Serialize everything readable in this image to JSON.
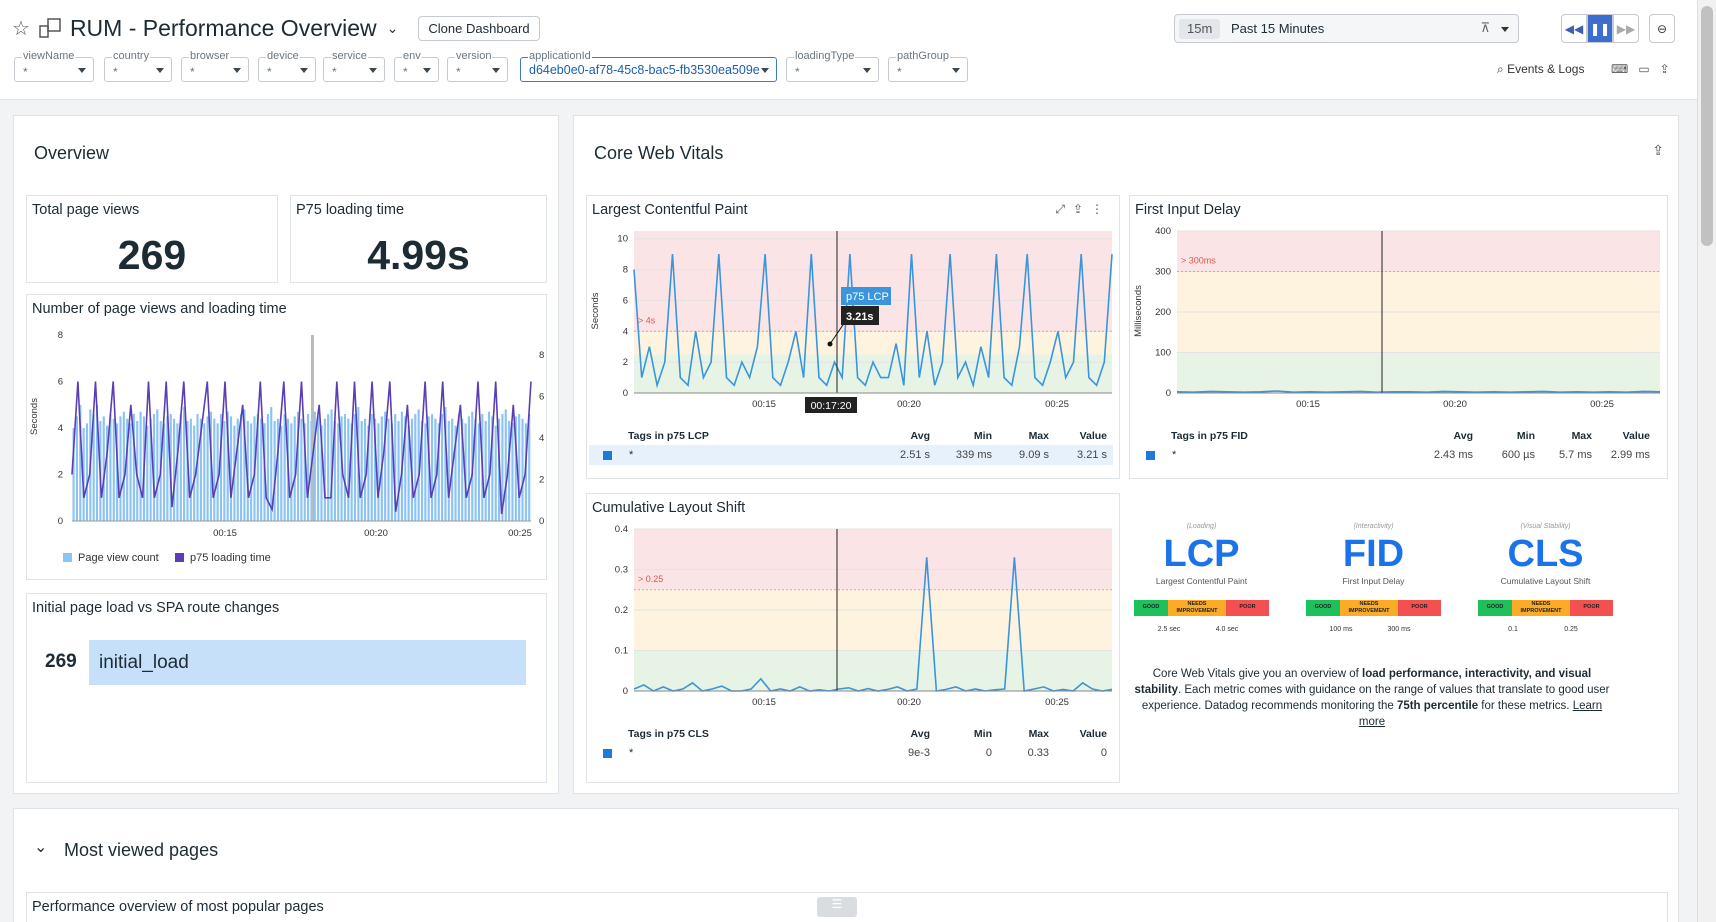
{
  "header": {
    "title": "RUM - Performance Overview",
    "clone_label": "Clone Dashboard",
    "time_short": "15m",
    "time_label": "Past 15 Minutes",
    "events_logs": "Events & Logs"
  },
  "variables": [
    {
      "name": "viewName",
      "value": "*"
    },
    {
      "name": "country",
      "value": "*"
    },
    {
      "name": "browser",
      "value": "*"
    },
    {
      "name": "device",
      "value": "*"
    },
    {
      "name": "service",
      "value": "*"
    },
    {
      "name": "env",
      "value": "*"
    },
    {
      "name": "version",
      "value": "*"
    },
    {
      "name": "applicationId",
      "value": "d64eb0e0-af78-45c8-bac5-fb3530ea509e"
    },
    {
      "name": "loadingType",
      "value": "*"
    },
    {
      "name": "pathGroup",
      "value": "*"
    }
  ],
  "overview": {
    "title": "Overview",
    "total_views_label": "Total page views",
    "total_views": "269",
    "p75_label": "P75 loading time",
    "p75_value": "4.99s",
    "views_chart_title": "Number of page views and loading time",
    "legend_views": "Page view count",
    "legend_loading": "p75 loading time",
    "spa_title": "Initial page load vs SPA route changes",
    "spa_count": "269",
    "spa_label": "initial_load"
  },
  "cwv": {
    "title": "Core Web Vitals",
    "lcp": {
      "title": "Largest Contentful Paint",
      "tags_label": "Tags in p75 LCP",
      "tag": "*",
      "avg": "2.51 s",
      "min": "339 ms",
      "max": "9.09 s",
      "value": "3.21 s",
      "threshold": "> 4s",
      "tooltip_name": "p75 LCP",
      "tooltip_val": "3.21s",
      "crosshair": "00:17:20"
    },
    "fid": {
      "title": "First Input Delay",
      "tags_label": "Tags in p75 FID",
      "tag": "*",
      "avg": "2.43 ms",
      "min": "600 µs",
      "max": "5.7 ms",
      "value": "2.99 ms",
      "threshold": "> 300ms"
    },
    "cls": {
      "title": "Cumulative Layout Shift",
      "tags_label": "Tags in p75 CLS",
      "tag": "*",
      "avg": "9e-3",
      "min": "0",
      "max": "0.33",
      "value": "0",
      "threshold": "> 0.25"
    },
    "col_avg": "Avg",
    "col_min": "Min",
    "col_max": "Max",
    "col_value": "Value",
    "vitals": [
      {
        "abbr": "LCP",
        "sub": "(Loading)",
        "name": "Largest Contentful Paint",
        "t1": "2.5 sec",
        "t2": "4.0 sec"
      },
      {
        "abbr": "FID",
        "sub": "(Interactivity)",
        "name": "First Input Delay",
        "t1": "100 ms",
        "t2": "300 ms"
      },
      {
        "abbr": "CLS",
        "sub": "(Visual Stability)",
        "name": "Cumulative Layout Shift",
        "t1": "0.1",
        "t2": "0.25"
      }
    ],
    "good": "GOOD",
    "needs": "NEEDS IMPROVEMENT",
    "poor": "POOR",
    "desc_1": "Core Web Vitals give you an overview of ",
    "desc_b1": "load performance, interactivity, and visual stability",
    "desc_2": ". Each metric comes with guidance on the range of values that translate to good user experience. Datadog recommends monitoring the ",
    "desc_b2": "75th percentile",
    "desc_3": " for these metrics. ",
    "learn_more": "Learn more"
  },
  "most_viewed": {
    "title": "Most viewed pages",
    "sub_title": "Performance overview of most popular pages"
  },
  "chart_data": [
    {
      "type": "bar",
      "title": "Number of page views and loading time",
      "ylabel": "Seconds",
      "x_ticks": [
        "00:15",
        "00:20",
        "00:25"
      ],
      "y_left": [
        0,
        2,
        4,
        6,
        8
      ],
      "y_right": [
        0,
        2,
        4,
        6,
        8
      ],
      "series": [
        {
          "name": "Page view count",
          "values": [
            4,
            4.5,
            5,
            4,
            4.2,
            4.8,
            4.6,
            5,
            4.3,
            4.5,
            4.1,
            4.6,
            4.4,
            4.2,
            4.5,
            4.7,
            4.4,
            4.2,
            4.6,
            4.3,
            4.7,
            4.5,
            4.1,
            4.4,
            4.6,
            4.8,
            4.3,
            4.2,
            4.5,
            4.6,
            4.4,
            4.2,
            4.6,
            4.9,
            4.3,
            4.4,
            4.1,
            4.6,
            4.4,
            4.2,
            4.5,
            4.7,
            4.4,
            4.2,
            4.6,
            4.3,
            4.7,
            4.5,
            4.1,
            4.4,
            4.6,
            4.8,
            4.3,
            4.2,
            4.5,
            4.6,
            4.4,
            4.2,
            4.6,
            4.9,
            4.3,
            4.4,
            4.1,
            4.6,
            4.4,
            4.2,
            4.5,
            4.7,
            4.4,
            4.2,
            4.6,
            4.3,
            4.7,
            4.5,
            4.1,
            4.4,
            4.6,
            4.8,
            4.3,
            4.2,
            4.5,
            4.6,
            4.4,
            4.2,
            4.6,
            4.9,
            4.3,
            4.4,
            4.1,
            4.6,
            4.4,
            4.2,
            4.5,
            4.7,
            4.4,
            4.2,
            4.6,
            4.3,
            4.7,
            4.5,
            4.1,
            4.4,
            4.6,
            4.8,
            4.3,
            4.2,
            4.5,
            4.6,
            4.4,
            4.2,
            4.6,
            4.9,
            4.3,
            4.4,
            4.1,
            4.6,
            4.4,
            4.2,
            4.5,
            4.7,
            4.4,
            4.2,
            4.6,
            4.3,
            4.7,
            4.5,
            4.1,
            4.4,
            4.6,
            4.8,
            4.3,
            4.2,
            4.5,
            4.6,
            4.4,
            4.2,
            4.6
          ]
        },
        {
          "name": "p75 loading time",
          "values": [
            2,
            6,
            1,
            2,
            6,
            1,
            3,
            6,
            1,
            2,
            5,
            2,
            1,
            6,
            1,
            2,
            6,
            0.6,
            3,
            6,
            1,
            2,
            4,
            6,
            1,
            2,
            6,
            1,
            3,
            5,
            1,
            2,
            6,
            1,
            0.5,
            3,
            6,
            1,
            2,
            6,
            1,
            3,
            5,
            1,
            1,
            6,
            2,
            1,
            6,
            1,
            2,
            6,
            1,
            3,
            6,
            0.4,
            2,
            5,
            1,
            2,
            6,
            1,
            2,
            6,
            1,
            3,
            5,
            1,
            2,
            6,
            1,
            2,
            6,
            0.3,
            2,
            5,
            1,
            2,
            6
          ]
        }
      ]
    },
    {
      "type": "line",
      "title": "Largest Contentful Paint",
      "ylabel": "Seconds",
      "y_ticks": [
        0,
        2,
        4,
        6,
        8,
        10
      ],
      "x_ticks": [
        "00:15",
        "00:20",
        "00:25"
      ],
      "series": [
        {
          "name": "p75 LCP",
          "values": [
            8,
            1,
            3,
            0.5,
            2,
            9,
            1,
            0.5,
            4,
            1,
            2,
            9,
            1,
            0.5,
            2,
            1,
            3,
            9,
            1,
            0.5,
            2,
            4,
            1,
            9,
            1,
            0.5,
            2,
            1,
            9,
            1,
            0.5,
            2,
            1,
            1,
            3.2,
            0.5,
            9,
            1,
            4,
            0.5,
            2,
            9,
            1,
            2,
            0.5,
            3,
            1,
            9,
            1,
            0.5,
            3,
            9,
            1,
            0.5,
            2,
            4,
            1,
            2,
            9,
            1,
            0.5,
            2,
            9
          ]
        }
      ]
    },
    {
      "type": "line",
      "title": "First Input Delay",
      "ylabel": "Milliseconds",
      "y_ticks": [
        0,
        100,
        200,
        300,
        400
      ],
      "x_ticks": [
        "00:15",
        "00:20",
        "00:25"
      ],
      "series": [
        {
          "name": "p75 FID",
          "values": [
            3,
            2,
            4,
            3,
            2,
            3,
            5,
            2,
            3,
            2,
            3,
            4,
            2,
            3,
            3,
            2,
            4,
            3,
            2,
            3,
            2,
            3,
            4,
            2,
            3,
            2,
            3,
            2,
            4,
            3
          ]
        }
      ]
    },
    {
      "type": "line",
      "title": "Cumulative Layout Shift",
      "y_ticks": [
        0,
        0.1,
        0.2,
        0.3,
        0.4
      ],
      "x_ticks": [
        "00:15",
        "00:20",
        "00:25"
      ],
      "series": [
        {
          "name": "p75 CLS",
          "values": [
            0.005,
            0.015,
            0,
            0.01,
            0,
            0.005,
            0.02,
            0,
            0.005,
            0.012,
            0,
            0,
            0.005,
            0.03,
            0,
            0.005,
            0,
            0.01,
            0,
            0.003,
            0,
            0.005,
            0.008,
            0,
            0.006,
            0,
            0.004,
            0.01,
            0,
            0.005,
            0.33,
            0,
            0.004,
            0.01,
            0,
            0.005,
            0,
            0.003,
            0.005,
            0.33,
            0,
            0.005,
            0.01,
            0,
            0.004,
            0,
            0.02,
            0.005,
            0,
            0.004
          ]
        }
      ]
    }
  ]
}
